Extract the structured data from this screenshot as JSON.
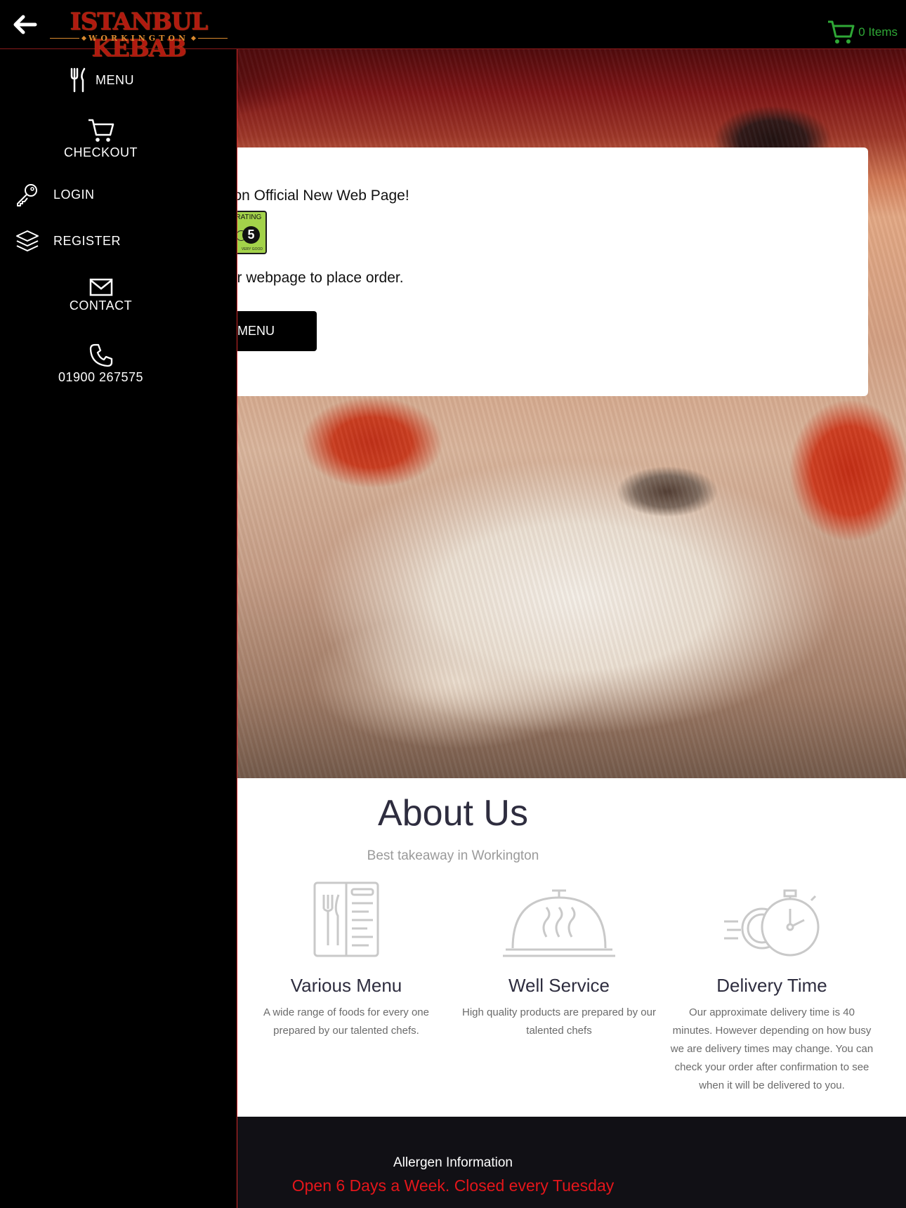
{
  "header": {
    "logo_main": "ISTANBUL KEBAB",
    "logo_sub": "WORKINGTON",
    "cart_label": "0 Items"
  },
  "sidebar": {
    "menu": "MENU",
    "checkout": "CHECKOUT",
    "login": "LOGIN",
    "register": "REGISTER",
    "contact": "CONTACT",
    "phone": "01900 267575"
  },
  "hero": {
    "welcome_text": "Workington Official New Web Page!",
    "hygiene_title": "HYGIENE RATING",
    "hygiene_score": "5",
    "hygiene_caption": "VERY GOOD",
    "order_text": "or use our webpage to place order.",
    "menu_button": "MENU"
  },
  "about": {
    "title": "About Us",
    "subtitle": "Best takeaway in Workington",
    "features": [
      {
        "title": "Various Menu",
        "text": "A wide range of foods for every one prepared by our talented chefs."
      },
      {
        "title": "Well Service",
        "text": "High quality products are prepared by our talented chefs"
      },
      {
        "title": "Delivery Time",
        "text": "Our approximate delivery time is 40 minutes. However depending on how busy we are delivery times may change. You can check your order after confirmation to see when it will be delivered to you."
      }
    ]
  },
  "footer": {
    "allergen": "Allergen Information",
    "hours": "Open 6 Days a Week. Closed every Tuesday"
  },
  "colors": {
    "cart_green": "#2fa836",
    "brand_red": "#b01a10",
    "hours_red": "#e4161b",
    "sidebar_border": "#d12a2a"
  }
}
